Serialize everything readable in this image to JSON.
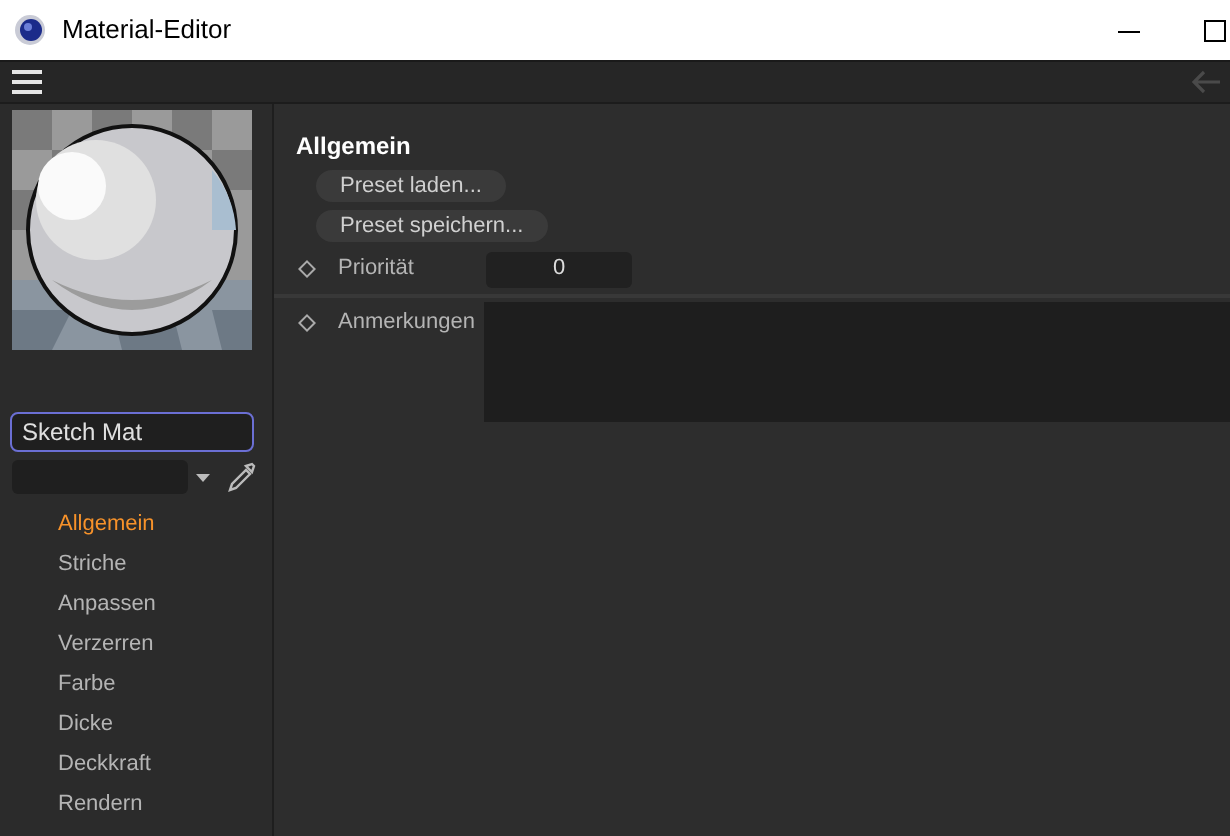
{
  "window": {
    "title": "Material-Editor"
  },
  "toolbar": {
    "back_disabled": true
  },
  "material": {
    "name": "Sketch Mat"
  },
  "sidebar": {
    "items": [
      {
        "label": "Allgemein",
        "selected": true
      },
      {
        "label": "Striche",
        "selected": false
      },
      {
        "label": "Anpassen",
        "selected": false
      },
      {
        "label": "Verzerren",
        "selected": false
      },
      {
        "label": "Farbe",
        "selected": false
      },
      {
        "label": "Dicke",
        "selected": false
      },
      {
        "label": "Deckkraft",
        "selected": false
      },
      {
        "label": "Rendern",
        "selected": false
      }
    ]
  },
  "section": {
    "title": "Allgemein",
    "buttons": [
      "Preset laden...",
      "Preset speichern..."
    ],
    "fields": [
      {
        "label": "Priorität",
        "kind": "number",
        "value": "0"
      },
      {
        "label": "Anmerkungen",
        "kind": "textarea"
      }
    ]
  }
}
